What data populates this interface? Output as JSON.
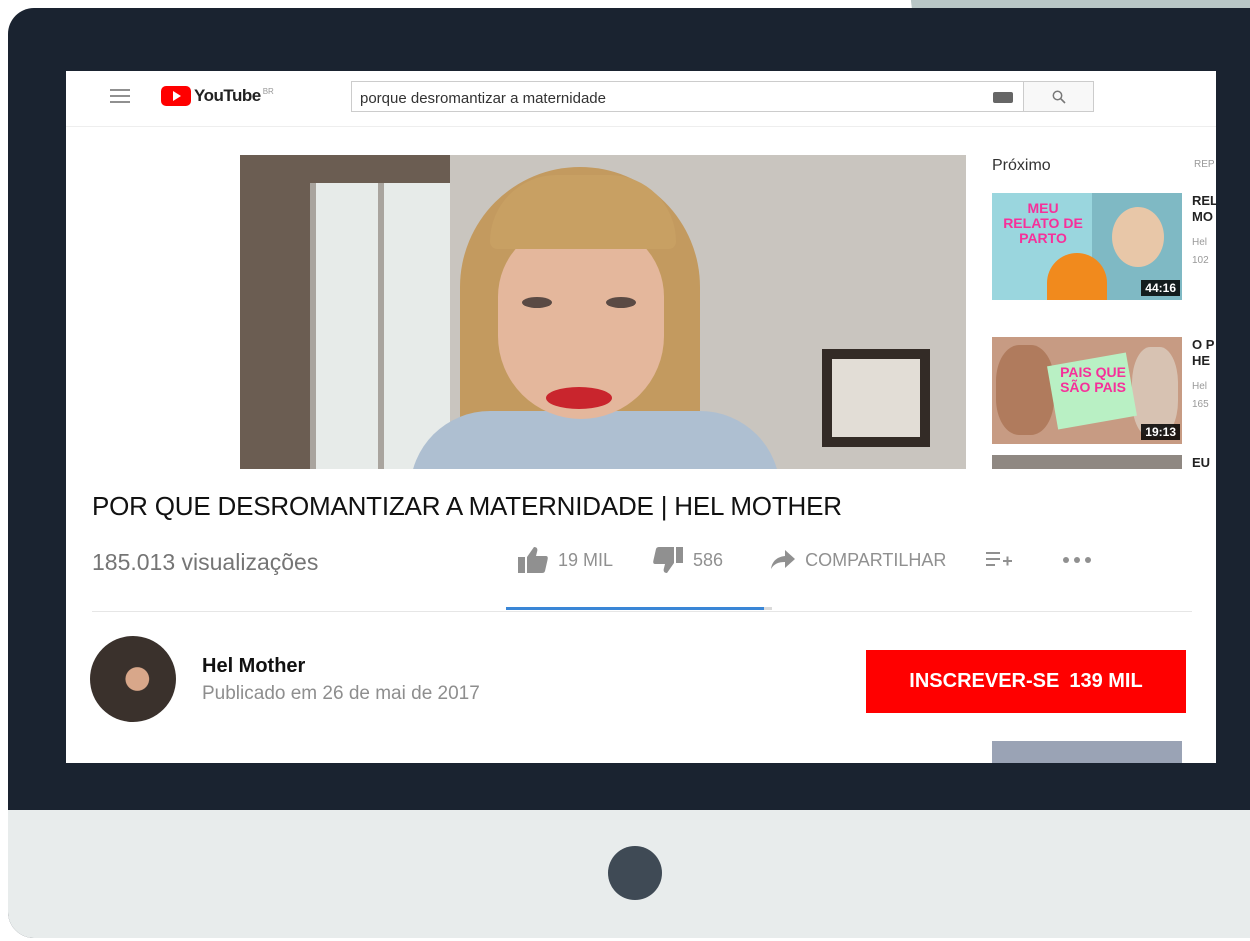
{
  "topbar": {
    "logo_text": "YouTube",
    "logo_country": "BR",
    "search_value": "porque desromantizar a maternidade"
  },
  "video": {
    "title": "POR QUE DESROMANTIZAR A MATERNIDADE | HEL MOTHER",
    "views": "185.013 visualizações",
    "likes": "19 MIL",
    "dislikes": "586",
    "share_label": "COMPARTILHAR",
    "like_ratio": 0.97
  },
  "channel": {
    "name": "Hel Mother",
    "published": "Publicado em 26 de mai de 2017",
    "subscribe_label": "INSCREVER-SE",
    "subscriber_count": "139 MIL"
  },
  "sidebar": {
    "up_next_label": "Próximo",
    "autoplay_label": "REP",
    "items": [
      {
        "title_line1": "REL",
        "title_line2": "MO",
        "channel": "Hel",
        "views": "102",
        "duration": "44:16",
        "sticker": "MEU RELATO DE PARTO"
      },
      {
        "title_line1": "O P",
        "title_line2": "HE",
        "channel": "Hel",
        "views": "165",
        "duration": "19:13",
        "sticker": "PAIS QUE SÃO PAIS"
      },
      {
        "title_line1": "EU",
        "title_line2": "",
        "channel": "",
        "views": "",
        "duration": "",
        "sticker": ""
      }
    ]
  },
  "colors": {
    "brand_red": "#ff0000",
    "monitor_frame": "#1a2330",
    "accent_blue": "#3a86d6"
  }
}
